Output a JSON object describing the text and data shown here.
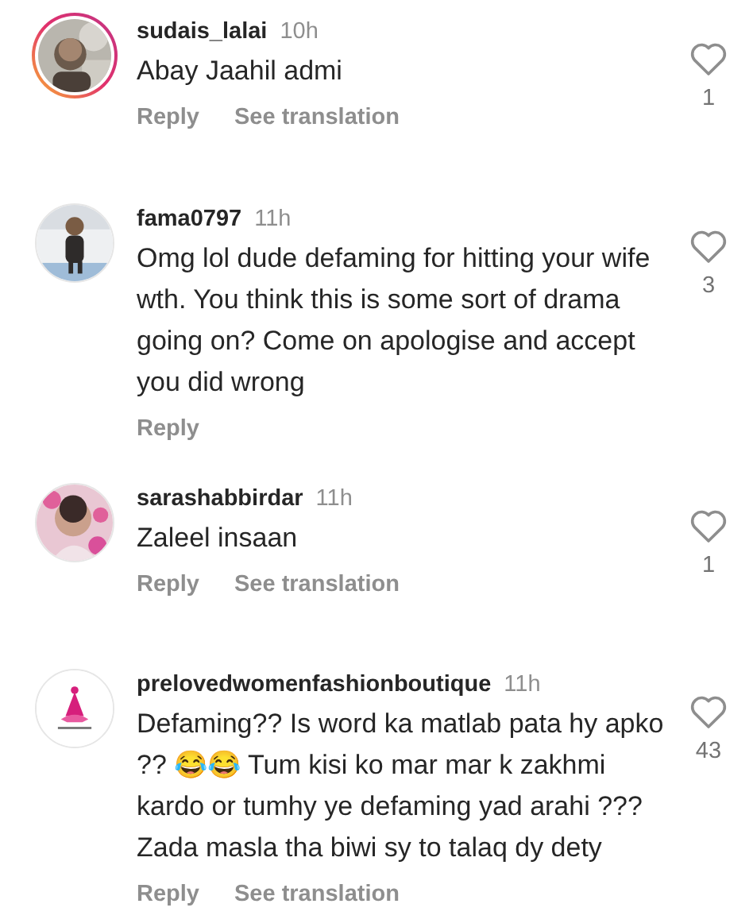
{
  "comments": [
    {
      "username": "sudais_lalai",
      "time": "10h",
      "text": "Abay Jaahil admi",
      "story_ring": true,
      "likes": "1",
      "actions": [
        "Reply",
        "See translation"
      ]
    },
    {
      "username": "fama0797",
      "time": "11h",
      "text": "Omg lol dude defaming for hitting your wife wth. You think this is some sort of drama going on? Come on apologise and accept you did wrong",
      "story_ring": false,
      "likes": "3",
      "actions": [
        "Reply"
      ]
    },
    {
      "username": "sarashabbirdar",
      "time": "11h",
      "text": "Zaleel insaan",
      "story_ring": false,
      "likes": "1",
      "actions": [
        "Reply",
        "See translation"
      ]
    },
    {
      "username": "prelovedwomenfashionboutique",
      "time": "11h",
      "text": "Defaming?? Is word ka matlab pata hy apko ?? 😂😂 Tum kisi ko mar mar k zakhmi kardo or tumhy ye defaming yad arahi ??? Zada masla tha biwi sy to talaq dy dety",
      "story_ring": false,
      "likes": "43",
      "actions": [
        "Reply",
        "See translation"
      ]
    }
  ]
}
